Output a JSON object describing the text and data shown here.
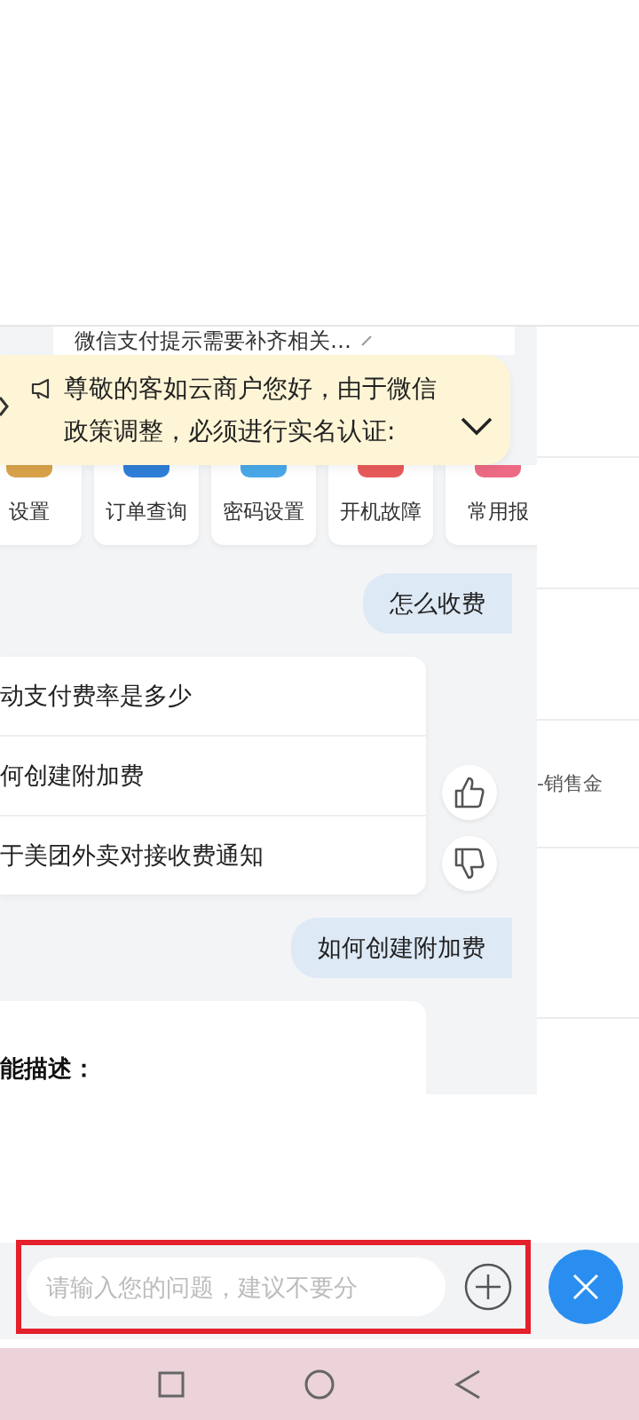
{
  "topic_link": {
    "text": "微信支付提示需要补齐相关…"
  },
  "notice": {
    "text": "尊敬的客如云商户您好，由于微信政策调整，必须进行实名认证:",
    "expanded": false
  },
  "quick_tiles": [
    {
      "label": "设置",
      "color": "#d9a24a"
    },
    {
      "label": "订单查询",
      "color": "#2f7fd8"
    },
    {
      "label": "密码设置",
      "color": "#4aa8e8"
    },
    {
      "label": "开机故障",
      "color": "#e85a5a"
    },
    {
      "label": "常用报",
      "color": "#ec6a84"
    }
  ],
  "messages": [
    {
      "kind": "user",
      "text": "怎么收费"
    },
    {
      "kind": "suggestions",
      "items": [
        "动支付费率是多少",
        "何创建附加费",
        "于美团外卖对接收费通知"
      ]
    },
    {
      "kind": "user",
      "text": "如何创建附加费"
    },
    {
      "kind": "answer",
      "text": "能描述："
    }
  ],
  "background_text": "-销售金",
  "input": {
    "placeholder": "请输入您的问题，建议不要分"
  }
}
